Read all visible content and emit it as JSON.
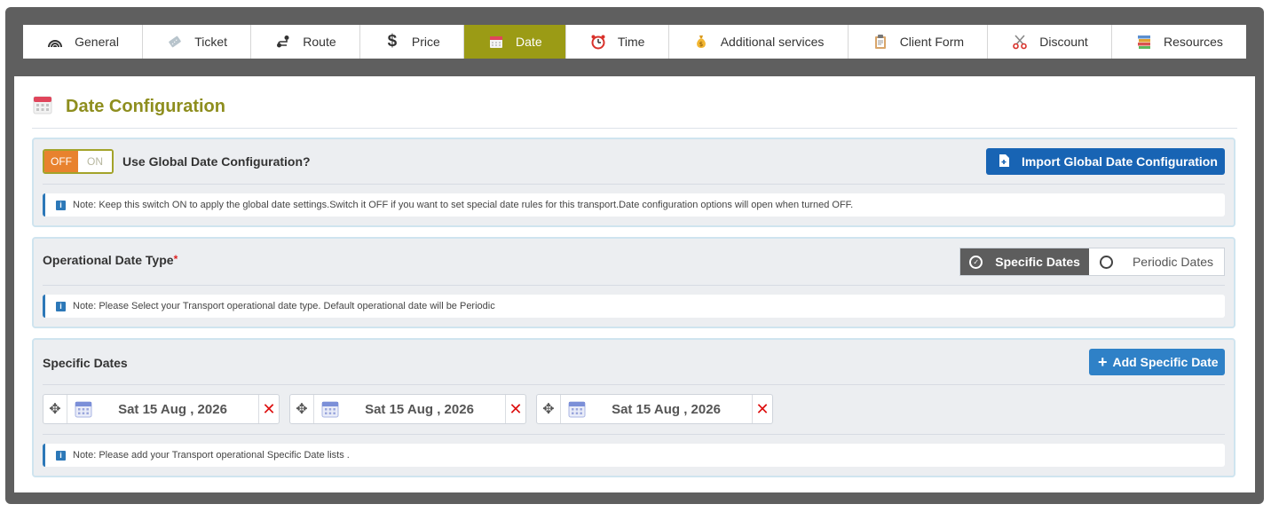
{
  "tabs": [
    {
      "label": "General",
      "icon": "rss-arc-icon"
    },
    {
      "label": "Ticket",
      "icon": "ticket-icon"
    },
    {
      "label": "Route",
      "icon": "route-icon"
    },
    {
      "label": "Price",
      "icon": "dollar-icon"
    },
    {
      "label": "Date",
      "icon": "calendar-icon",
      "active": true
    },
    {
      "label": "Time",
      "icon": "alarm-clock-icon"
    },
    {
      "label": "Additional services",
      "icon": "money-bag-icon"
    },
    {
      "label": "Client Form",
      "icon": "clipboard-icon"
    },
    {
      "label": "Discount",
      "icon": "scissors-icon"
    },
    {
      "label": "Resources",
      "icon": "books-icon"
    }
  ],
  "page": {
    "title": "Date Configuration"
  },
  "global": {
    "toggle_off": "OFF",
    "toggle_on": "ON",
    "label": "Use Global Date Configuration?",
    "import_button": "Import Global Date Configuration",
    "note": "Note: Keep this switch ON to apply the global date settings.Switch it OFF if you want to set special date rules for this transport.Date configuration options will open when turned OFF."
  },
  "type": {
    "label": "Operational Date Type",
    "required_mark": "*",
    "options": [
      "Specific Dates",
      "Periodic Dates"
    ],
    "selected": "Specific Dates",
    "note": "Note: Please Select your Transport operational date type. Default operational date will be Periodic"
  },
  "specific": {
    "label": "Specific Dates",
    "add_button": "Add Specific Date",
    "dates": [
      "Sat 15 Aug , 2026",
      "Sat 15 Aug , 2026",
      "Sat 15 Aug , 2026"
    ],
    "note": "Note: Please add your Transport operational Specific Date lists ."
  },
  "colors": {
    "frame": "#5f5f5f",
    "active_tab": "#9b9b15",
    "heading": "#8e8e1e",
    "primary": "#1864b4",
    "toggle_off": "#e8822e",
    "delete": "#dd1111"
  }
}
